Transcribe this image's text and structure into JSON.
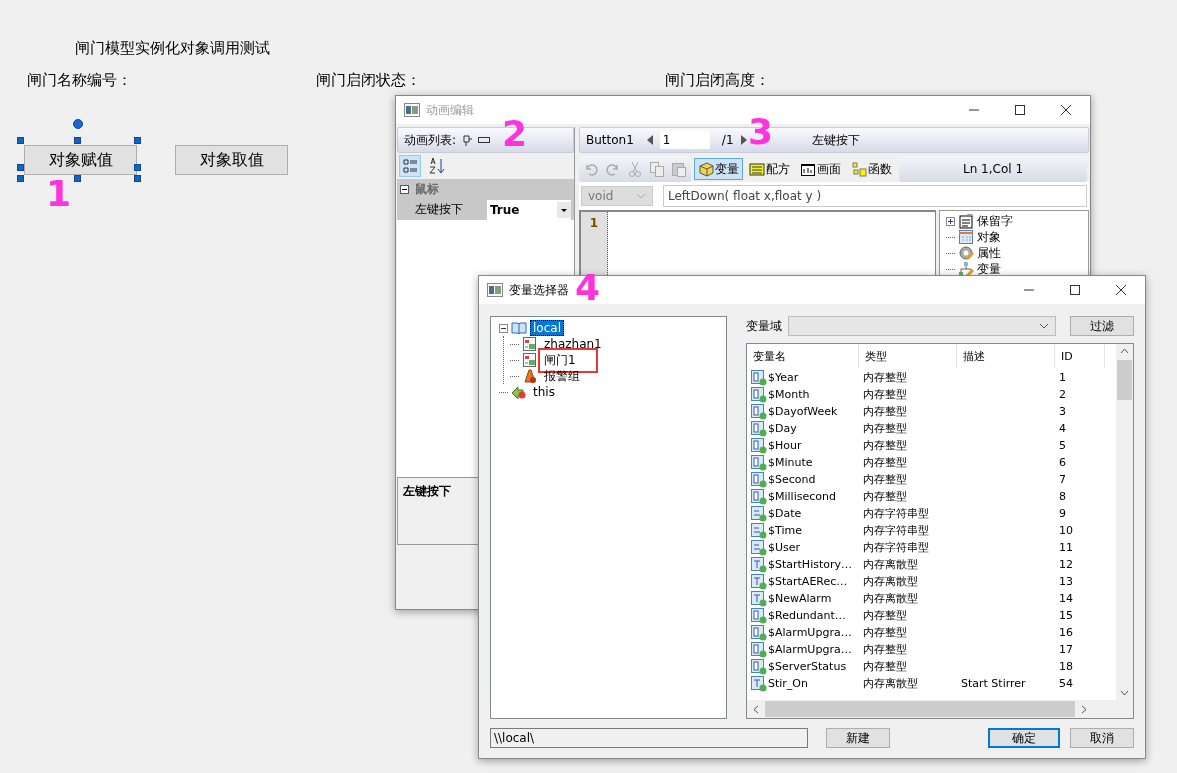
{
  "form": {
    "title": "闸门模型实例化对象调用测试",
    "labels": [
      "闸门名称编号：",
      "闸门启闭状态：",
      "闸门启闭高度："
    ],
    "buttons": [
      {
        "label": "对象赋值",
        "selected": true
      },
      {
        "label": "对象取值",
        "selected": false
      }
    ]
  },
  "anim_editor": {
    "title": "动画编辑",
    "active": false,
    "list_header": "动画列表:",
    "group": {
      "label": "鼠标",
      "expanded": true
    },
    "property": {
      "name": "左键按下",
      "value": "True"
    },
    "description": "左键按下",
    "object": "Button1",
    "page": "1",
    "page_total": "/1",
    "event": "左键按下",
    "tools": [
      {
        "kind": "undo",
        "disabled": true
      },
      {
        "kind": "redo",
        "disabled": true
      },
      {
        "kind": "cut",
        "disabled": true
      },
      {
        "kind": "copy",
        "disabled": true
      },
      {
        "kind": "paste",
        "disabled": true
      }
    ],
    "tabs": [
      {
        "label": "变量",
        "kind": "variable",
        "selected": true
      },
      {
        "label": "配方",
        "kind": "recipe",
        "selected": false
      },
      {
        "label": "画面",
        "kind": "screen",
        "selected": false
      },
      {
        "label": "函数",
        "kind": "function",
        "selected": false
      }
    ],
    "position": "Ln 1,Col 1",
    "return_type": {
      "value": "void",
      "disabled": true
    },
    "signature": "LeftDown( float x,float y )",
    "line_number": "1",
    "tree": [
      {
        "label": "保留字",
        "kind": "reserved",
        "expanded": false
      },
      {
        "label": "对象",
        "kind": "object"
      },
      {
        "label": "属性",
        "kind": "property"
      },
      {
        "label": "变量",
        "kind": "variable"
      }
    ]
  },
  "var_selector": {
    "title": "变量选择器",
    "active": true,
    "tree": [
      {
        "label": "local",
        "kind": "book",
        "selected": true,
        "expanded": true,
        "marked": false,
        "children": [
          {
            "label": "zhazhan1",
            "kind": "model",
            "selected": false,
            "marked": false
          },
          {
            "label": "闸门1",
            "kind": "model",
            "selected": false,
            "marked": true
          },
          {
            "label": "报警组",
            "kind": "alarm",
            "selected": false,
            "marked": false
          }
        ]
      },
      {
        "label": "this",
        "kind": "this",
        "selected": false,
        "marked": false
      }
    ],
    "scope_label": "变量域",
    "filter_button": "过滤",
    "columns": [
      "变量名",
      "类型",
      "描述",
      "ID"
    ],
    "rows": [
      {
        "name": "$Year",
        "type": "内存整型",
        "id": "1",
        "kind": "int"
      },
      {
        "name": "$Month",
        "type": "内存整型",
        "id": "2",
        "kind": "int"
      },
      {
        "name": "$DayofWeek",
        "type": "内存整型",
        "id": "3",
        "kind": "int"
      },
      {
        "name": "$Day",
        "type": "内存整型",
        "id": "4",
        "kind": "int"
      },
      {
        "name": "$Hour",
        "type": "内存整型",
        "id": "5",
        "kind": "int"
      },
      {
        "name": "$Minute",
        "type": "内存整型",
        "id": "6",
        "kind": "int"
      },
      {
        "name": "$Second",
        "type": "内存整型",
        "id": "7",
        "kind": "int"
      },
      {
        "name": "$Millisecond",
        "type": "内存整型",
        "id": "8",
        "kind": "int"
      },
      {
        "name": "$Date",
        "type": "内存字符串型",
        "id": "9",
        "kind": "string"
      },
      {
        "name": "$Time",
        "type": "内存字符串型",
        "id": "10",
        "kind": "string"
      },
      {
        "name": "$User",
        "type": "内存字符串型",
        "id": "11",
        "kind": "string"
      },
      {
        "name": "$StartHistory…",
        "type": "内存离散型",
        "id": "12",
        "kind": "discrete"
      },
      {
        "name": "$StartAERec…",
        "type": "内存离散型",
        "id": "13",
        "kind": "discrete"
      },
      {
        "name": "$NewAlarm",
        "type": "内存离散型",
        "id": "14",
        "kind": "discrete"
      },
      {
        "name": "$Redundant…",
        "type": "内存整型",
        "id": "15",
        "kind": "int"
      },
      {
        "name": "$AlarmUpgra…",
        "type": "内存整型",
        "id": "16",
        "kind": "int"
      },
      {
        "name": "$AlarmUpgra…",
        "type": "内存整型",
        "id": "17",
        "kind": "int"
      },
      {
        "name": "$ServerStatus",
        "type": "内存整型",
        "id": "18",
        "kind": "int"
      },
      {
        "name": "Stir_On",
        "type": "内存离散型",
        "description": "Start Stirrer",
        "id": "54",
        "kind": "discrete"
      }
    ],
    "path": "\\\\local\\",
    "buttons": [
      {
        "label": "新建",
        "default": false
      },
      {
        "label": "确定",
        "default": true
      },
      {
        "label": "取消",
        "default": false
      }
    ]
  },
  "annotations": [
    "1",
    "2",
    "3",
    "4"
  ]
}
